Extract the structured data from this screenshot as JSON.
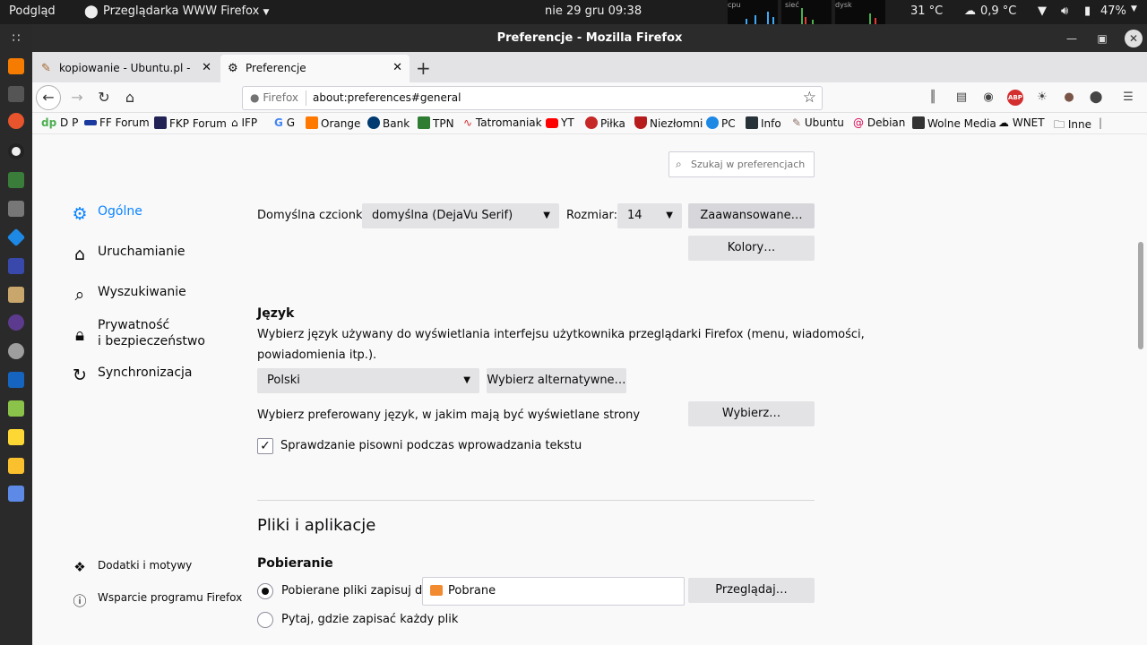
{
  "topbar": {
    "activities": "Podgląd",
    "app_menu": "Przeglądarka WWW Firefox",
    "datetime": "nie 29 gru  09:38",
    "graph_cpu": "cpu",
    "graph_net": "sieć",
    "graph_disk": "dysk",
    "cpu_temp": "31 °C",
    "weather": "0,9 °C",
    "battery": "47%"
  },
  "window": {
    "title": "Preferencje - Mozilla Firefox"
  },
  "tabs": [
    {
      "label": "kopiowanie - Ubuntu.pl - Forum"
    },
    {
      "label": "Preferencje"
    }
  ],
  "navbar": {
    "identity": "Firefox",
    "url": "about:preferences#general"
  },
  "bookmarks": [
    {
      "label": "D P",
      "prefix": "dp",
      "color": "#4caf50"
    },
    {
      "label": "FF Forum",
      "color": "#1a3aa0"
    },
    {
      "label": "FKP Forum",
      "color": "#222255"
    },
    {
      "label": "IFP",
      "color": "#333333"
    },
    {
      "label": "G",
      "color": "#4285f4"
    },
    {
      "label": "Orange",
      "color": "#ff7900"
    },
    {
      "label": "Bank",
      "color": "#003a70"
    },
    {
      "label": "TPN",
      "color": "#2e7d32"
    },
    {
      "label": "Tatromaniak",
      "color": "#d32f2f"
    },
    {
      "label": "YT",
      "color": "#ff0000"
    },
    {
      "label": "Piłka",
      "color": "#c62828"
    },
    {
      "label": "Niezłomni",
      "color": "#b71c1c"
    },
    {
      "label": "PC",
      "color": "#1e88e5"
    },
    {
      "label": "Info",
      "color": "#263238"
    },
    {
      "label": "Ubuntu",
      "color": "#8d6e63"
    },
    {
      "label": "Debian",
      "color": "#d70751"
    },
    {
      "label": "Wolne Media",
      "color": "#333333"
    },
    {
      "label": "WNET",
      "color": "#555555"
    },
    {
      "label": "Inne",
      "color": "#777777"
    }
  ],
  "prefs": {
    "search_placeholder": "Szukaj w preferencjach",
    "categories": [
      {
        "label": "Ogólne",
        "icon": "gear-icon"
      },
      {
        "label": "Uruchamianie",
        "icon": "home-icon"
      },
      {
        "label": "Wyszukiwanie",
        "icon": "search-icon"
      },
      {
        "label": "Prywatność",
        "label2": "i bezpieczeństwo",
        "icon": "lock-icon"
      },
      {
        "label": "Synchronizacja",
        "icon": "sync-icon"
      }
    ],
    "footer": [
      {
        "label": "Dodatki i motywy",
        "icon": "puzzle-icon"
      },
      {
        "label": "Wsparcie programu Firefox",
        "icon": "help-icon"
      }
    ],
    "font_label": "Domyślna czcionka:",
    "font_value": "domyślna (DejaVu Serif)",
    "size_label": "Rozmiar:",
    "size_value": "14",
    "advanced_button": "Zaawansowane…",
    "colors_button": "Kolory…",
    "language_heading": "Język",
    "language_desc_1": "Wybierz język używany do wyświetlania interfejsu użytkownika przeglądarki Firefox (menu, wiadomości,",
    "language_desc_2": "powiadomienia itp.).",
    "language_value": "Polski",
    "alt_languages_button": "Wybierz alternatywne…",
    "page_language_label": "Wybierz preferowany język, w jakim mają być wyświetlane strony",
    "choose_button": "Wybierz…",
    "spellcheck_label": "Sprawdzanie pisowni podczas wprowadzania tekstu",
    "spellcheck_checked": true,
    "files_heading": "Pliki i aplikacje",
    "downloads_heading": "Pobieranie",
    "save_to_label": "Pobierane pliki zapisuj do:",
    "download_folder": "Pobrane",
    "browse_button": "Przeglądaj…",
    "ask_label": "Pytaj, gdzie zapisać każdy plik"
  }
}
